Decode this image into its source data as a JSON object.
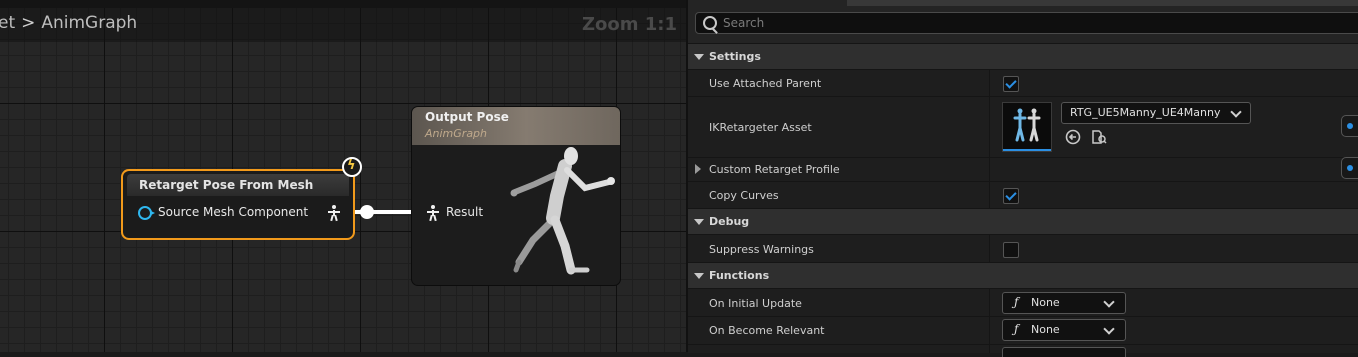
{
  "graph": {
    "breadcrumb": [
      "et",
      "AnimGraph"
    ],
    "zoom_label": "Zoom 1:1",
    "nodes": {
      "retarget": {
        "title": "Retarget Pose From Mesh",
        "pin_label": "Source Mesh Component",
        "fast_path_icon": "lightning-icon"
      },
      "output": {
        "title": "Output Pose",
        "subtitle": "AnimGraph",
        "pin_label": "Result"
      }
    }
  },
  "details": {
    "search": {
      "placeholder": "Search"
    },
    "categories": {
      "settings": "Settings",
      "debug": "Debug",
      "functions": "Functions"
    },
    "settings": {
      "use_attached_parent": {
        "label": "Use Attached Parent",
        "checked": true
      },
      "ik_retargeter_asset": {
        "label": "IKRetargeter Asset",
        "value": "RTG_UE5Manny_UE4Manny"
      },
      "custom_retarget_profile": {
        "label": "Custom Retarget Profile"
      },
      "copy_curves": {
        "label": "Copy Curves",
        "checked": true
      }
    },
    "debug": {
      "suppress_warnings": {
        "label": "Suppress Warnings",
        "checked": false
      }
    },
    "functions": {
      "on_initial_update": {
        "label": "On Initial Update",
        "glyph": "ƒ",
        "value": "None"
      },
      "on_become_relevant": {
        "label": "On Become Relevant",
        "glyph": "ƒ",
        "value": "None"
      }
    },
    "colors": {
      "accent": "#2b8fe3",
      "selection": "#f29a1b"
    }
  }
}
